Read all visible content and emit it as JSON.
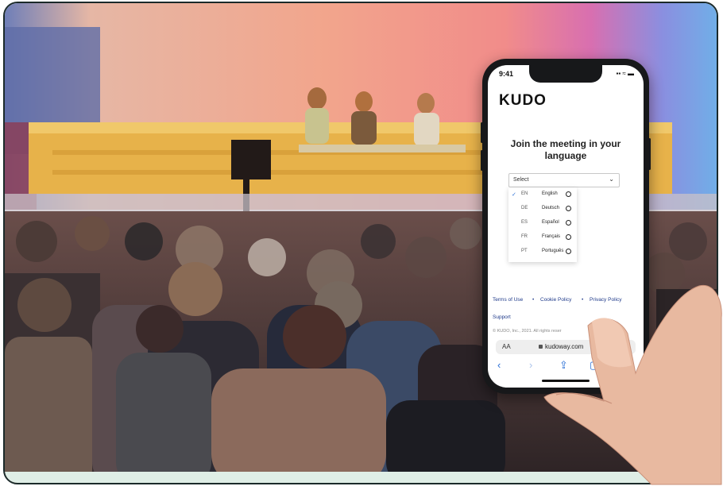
{
  "phone": {
    "time": "9:41",
    "status_icons": "▪▪ ≈ ▬",
    "logo": "KUDO",
    "join_title": "Join the meeting in your language",
    "select_placeholder": "Select",
    "languages": [
      {
        "code": "EN",
        "name": "English",
        "selected": true
      },
      {
        "code": "DE",
        "name": "Deutsch",
        "selected": false
      },
      {
        "code": "ES",
        "name": "Español",
        "selected": false
      },
      {
        "code": "FR",
        "name": "Français",
        "selected": false
      },
      {
        "code": "PT",
        "name": "Português",
        "selected": false
      }
    ],
    "links": {
      "terms": "Terms of Use",
      "cookie": "Cookie Policy",
      "privacy": "Privacy Policy",
      "support": "Support"
    },
    "copyright": "© KUDO, Inc., 2021. All rights reser",
    "url_aa": "AA",
    "url": "kudoway.com"
  },
  "colors": {
    "frame_border": "#1b2a2a",
    "bottom_strip": "#dfeee6",
    "link_blue": "#1f3a8a",
    "ios_blue": "#2a6fd6"
  },
  "icons": {
    "check": "check-icon",
    "chevron": "chevron-down-icon",
    "lock": "lock-icon",
    "back": "back-arrow-icon",
    "forward": "forward-arrow-icon",
    "share": "share-icon",
    "bookmarks": "book-icon",
    "interpreter": "headphones-icon"
  }
}
